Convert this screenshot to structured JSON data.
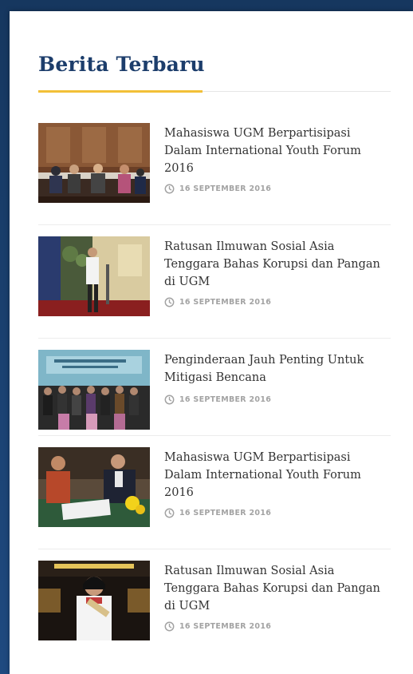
{
  "widget": {
    "title": "Berita Terbaru",
    "accent_color": "#f2c037",
    "title_color": "#1c3d6b"
  },
  "news": [
    {
      "headline": "Mahasiswa UGM Berpartisipasi Dalam International Youth Forum 2016",
      "date": "16 SEPTEMBER 2016",
      "icon": "clock-icon"
    },
    {
      "headline": "Ratusan Ilmuwan Sosial Asia Tenggara Bahas Korupsi dan Pangan di UGM",
      "date": "16 SEPTEMBER 2016",
      "icon": "clock-icon"
    },
    {
      "headline": "Penginderaan Jauh Penting Untuk Mitigasi Bencana",
      "date": "16 SEPTEMBER 2016",
      "icon": "clock-icon"
    },
    {
      "headline": "Mahasiswa UGM Berpartisipasi Dalam International Youth Forum 2016",
      "date": "16 SEPTEMBER 2016",
      "icon": "clock-icon"
    },
    {
      "headline": "Ratusan Ilmuwan Sosial Asia Tenggara Bahas Korupsi dan Pangan di UGM",
      "date": "16 SEPTEMBER 2016",
      "icon": "clock-icon"
    }
  ]
}
